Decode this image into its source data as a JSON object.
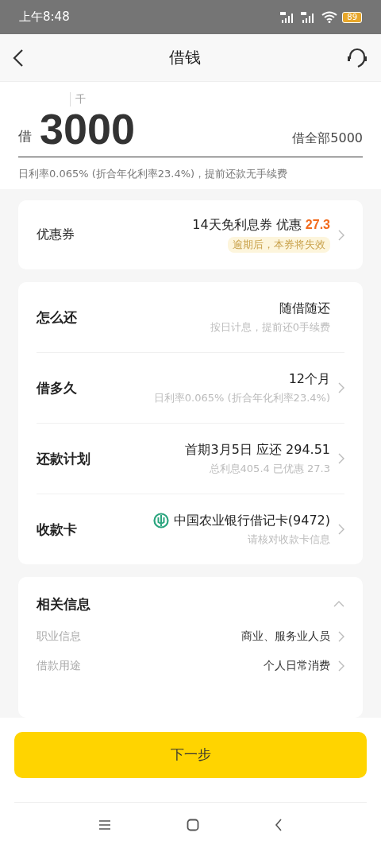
{
  "status_bar": {
    "time": "上午8:48",
    "battery": "89"
  },
  "header": {
    "title": "借钱"
  },
  "amount": {
    "unit_hint": "千",
    "prefix": "借",
    "value": "3000",
    "borrow_all": "借全部5000",
    "rate_note": "日利率0.065% (折合年化利率23.4%)，提前还款无手续费"
  },
  "coupon": {
    "label": "优惠券",
    "value": "14天免利息券 优惠 ",
    "discount": "27.3",
    "badge": "逾期后，本券将失效"
  },
  "loan_rows": [
    {
      "kind": "fixed",
      "label": "怎么还",
      "value": "随借随还",
      "sub": "按日计息，提前还0手续费"
    },
    {
      "kind": "select",
      "label": "借多久",
      "value": "12个月",
      "sub": "日利率0.065% (折合年化利率23.4%)"
    },
    {
      "kind": "select",
      "label": "还款计划",
      "value": "首期3月5日 应还 294.51",
      "sub": "总利息405.4 已优惠 27.3"
    },
    {
      "kind": "card",
      "label": "收款卡",
      "value": "中国农业银行借记卡(9472)",
      "sub": "请核对收款卡信息"
    }
  ],
  "related": {
    "title": "相关信息",
    "expanded": true,
    "items": [
      {
        "label": "职业信息",
        "value": "商业、服务业人员"
      },
      {
        "label": "借款用途",
        "value": "个人日常消费"
      }
    ]
  },
  "next_button": "下一步"
}
